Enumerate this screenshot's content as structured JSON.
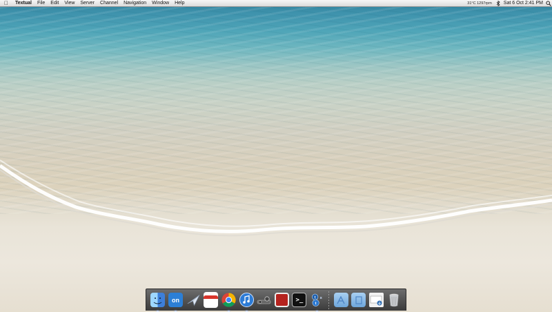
{
  "menubar": {
    "apple_icon": "apple-logo",
    "app_name": "Textual",
    "menus": [
      "File",
      "Edit",
      "View",
      "Server",
      "Channel",
      "Navigation",
      "Window",
      "Help"
    ],
    "status_text": "31°C 1297rpm",
    "clock": "Sat 6 Oct  2:41 PM",
    "icons": [
      "bluetooth-icon",
      "search-icon"
    ]
  },
  "dock": {
    "calendar_day": "6",
    "onlive_label": "on",
    "terminal_prompt": ">_",
    "apps": [
      {
        "name": "Finder",
        "running": true
      },
      {
        "name": "OnLive",
        "running": true
      },
      {
        "name": "Mail",
        "running": false
      },
      {
        "name": "Calendar",
        "running": false
      },
      {
        "name": "Google Chrome",
        "running": true
      },
      {
        "name": "iTunes",
        "running": true
      },
      {
        "name": "Steam",
        "running": false
      },
      {
        "name": "Photo Booth",
        "running": false
      },
      {
        "name": "Terminal",
        "running": false
      },
      {
        "name": "Textual",
        "running": true
      }
    ],
    "stacks": [
      "Applications",
      "Documents",
      "Downloads",
      "Trash"
    ]
  },
  "colors": {
    "dock_bg": "#3b3b3b",
    "menubar_bg": "#e6e6e6",
    "sea": "#3f93ad",
    "sand": "#e9e4d8"
  }
}
